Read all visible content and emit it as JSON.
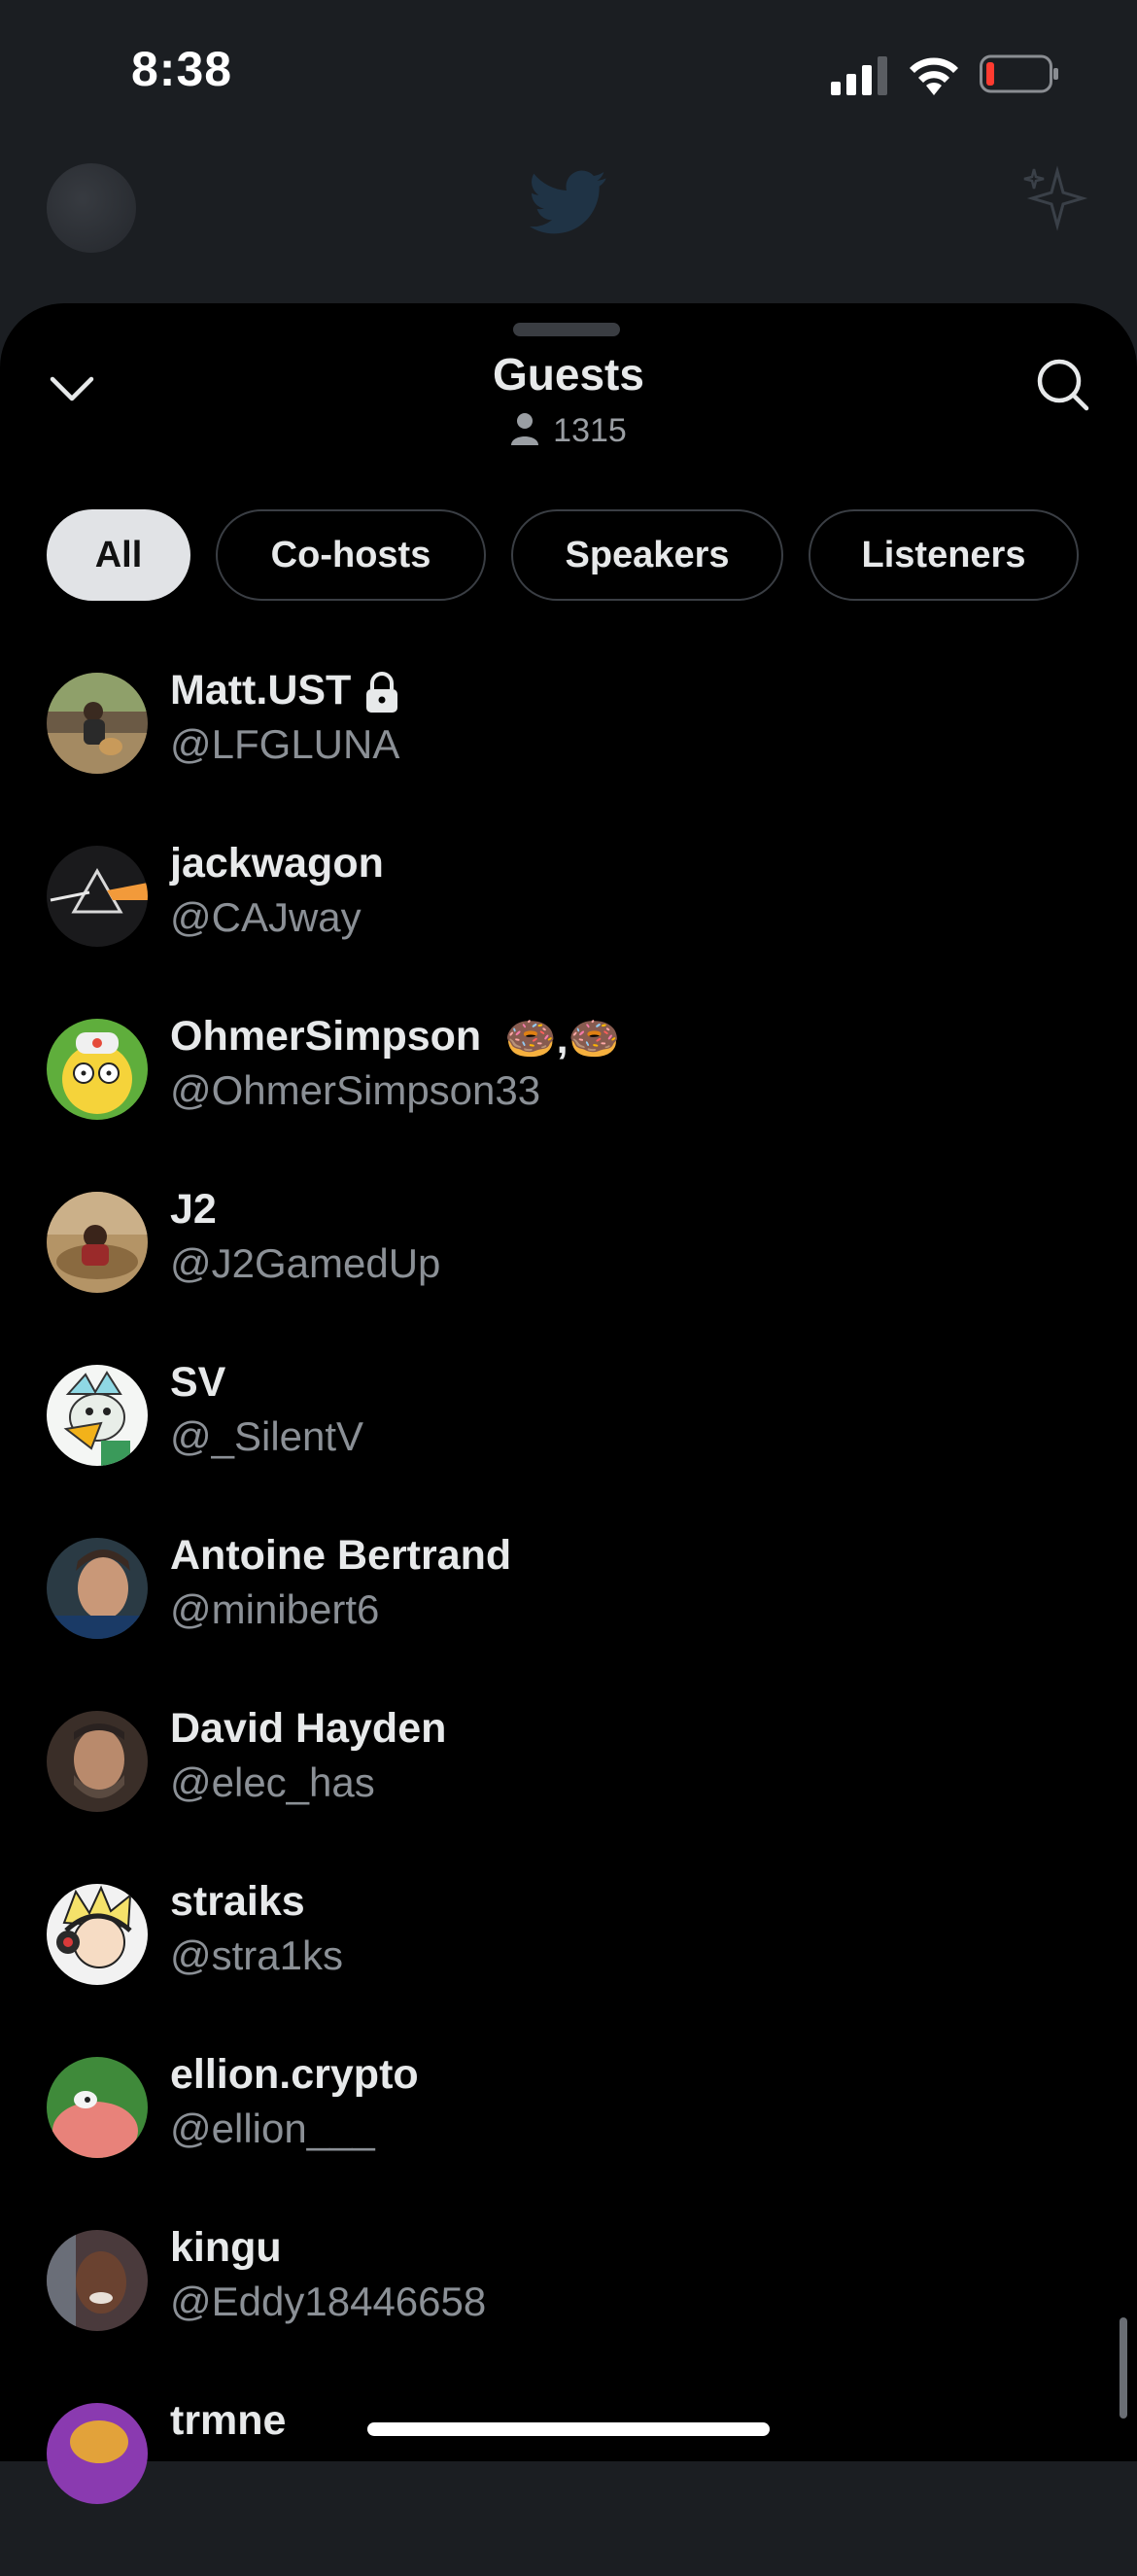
{
  "status_bar": {
    "time": "8:38"
  },
  "sheet": {
    "title": "Guests",
    "guest_count": "1315",
    "tabs": [
      {
        "label": "All",
        "active": true
      },
      {
        "label": "Co-hosts",
        "active": false
      },
      {
        "label": "Speakers",
        "active": false
      },
      {
        "label": "Listeners",
        "active": false
      }
    ]
  },
  "guests": [
    {
      "name": "Matt.UST",
      "handle": "@LFGLUNA",
      "badge": "lock-icon"
    },
    {
      "name": "jackwagon",
      "handle": "@CAJway"
    },
    {
      "name": "OhmerSimpson",
      "handle": "@OhmerSimpson33",
      "badge": "donut-emoji",
      "badge_text": "🍩,🍩"
    },
    {
      "name": "J2",
      "handle": "@J2GamedUp"
    },
    {
      "name": "SV",
      "handle": "@_SilentV"
    },
    {
      "name": "Antoine Bertrand",
      "handle": "@minibert6"
    },
    {
      "name": "David Hayden",
      "handle": "@elec_has"
    },
    {
      "name": "straiks",
      "handle": "@stra1ks"
    },
    {
      "name": "ellion.crypto",
      "handle": "@ellion___"
    },
    {
      "name": "kingu",
      "handle": "@Eddy18446658"
    },
    {
      "name": "trmne",
      "handle": ""
    }
  ],
  "colors": {
    "background": "#000000",
    "tab_active_bg": "#e1e3e6",
    "handle_text": "#8b9096"
  }
}
